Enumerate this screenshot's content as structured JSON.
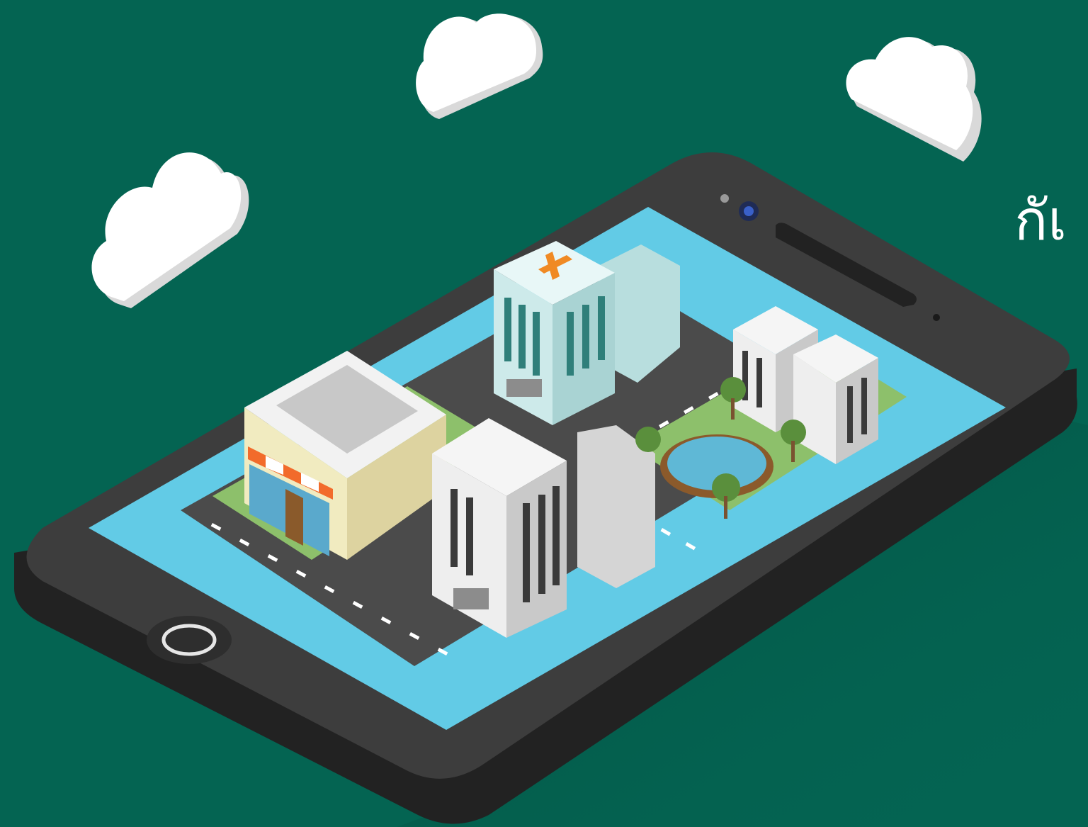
{
  "scene": {
    "background_color": "#046452",
    "heading_text": "กัเ",
    "objects": [
      "cloud",
      "cloud",
      "cloud",
      "smartphone",
      "camera-icon",
      "speaker-grille",
      "home-button",
      "hospital-building",
      "shop-building",
      "apartment-building",
      "office-tower",
      "park",
      "fountain-pond",
      "tree",
      "road",
      "river"
    ],
    "colors": {
      "phone_body": "#3d3d3d",
      "screen_water": "#62cbe6",
      "grass": "#8dc06b",
      "road": "#4b4b4b",
      "building": "#f0f0f0",
      "hospital_cross": "#f08a24",
      "awning": "#f26b2b"
    }
  }
}
